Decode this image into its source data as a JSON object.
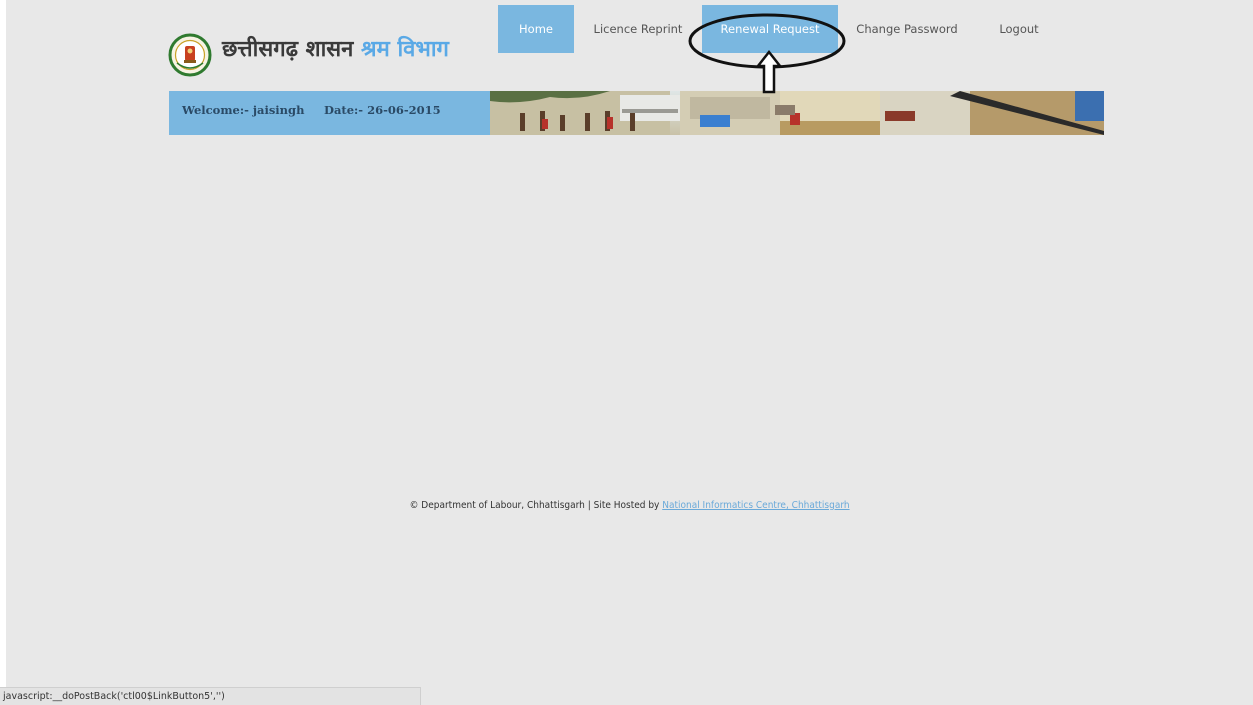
{
  "header": {
    "title_part1": "छत्तीसगढ़ शासन",
    "title_part2": "श्रम विभाग",
    "logo_icon": "state-emblem-icon"
  },
  "nav": {
    "items": [
      {
        "label": "Home",
        "active": true
      },
      {
        "label": "Licence Reprint",
        "active": false
      },
      {
        "label": "Renewal Request",
        "active": true
      },
      {
        "label": "Change Password",
        "active": false
      },
      {
        "label": "Logout",
        "active": false
      }
    ]
  },
  "welcome_bar": {
    "welcome": "Welcome:- jaisingh",
    "date": "Date:- 26-06-2015"
  },
  "footer": {
    "copyright": "© Department of Labour, Chhattisgarh | Site Hosted by",
    "link": "National Informatics Centre, Chhattisgarh"
  },
  "status_bar": {
    "text": "javascript:__doPostBack('ctl00$LinkButton5','')"
  },
  "colors": {
    "accent": "#7ab7e0",
    "title_blue": "#5aa9e6",
    "page_bg": "#e8e8e8"
  },
  "annotation": {
    "shape": "ellipse-with-up-arrow"
  }
}
